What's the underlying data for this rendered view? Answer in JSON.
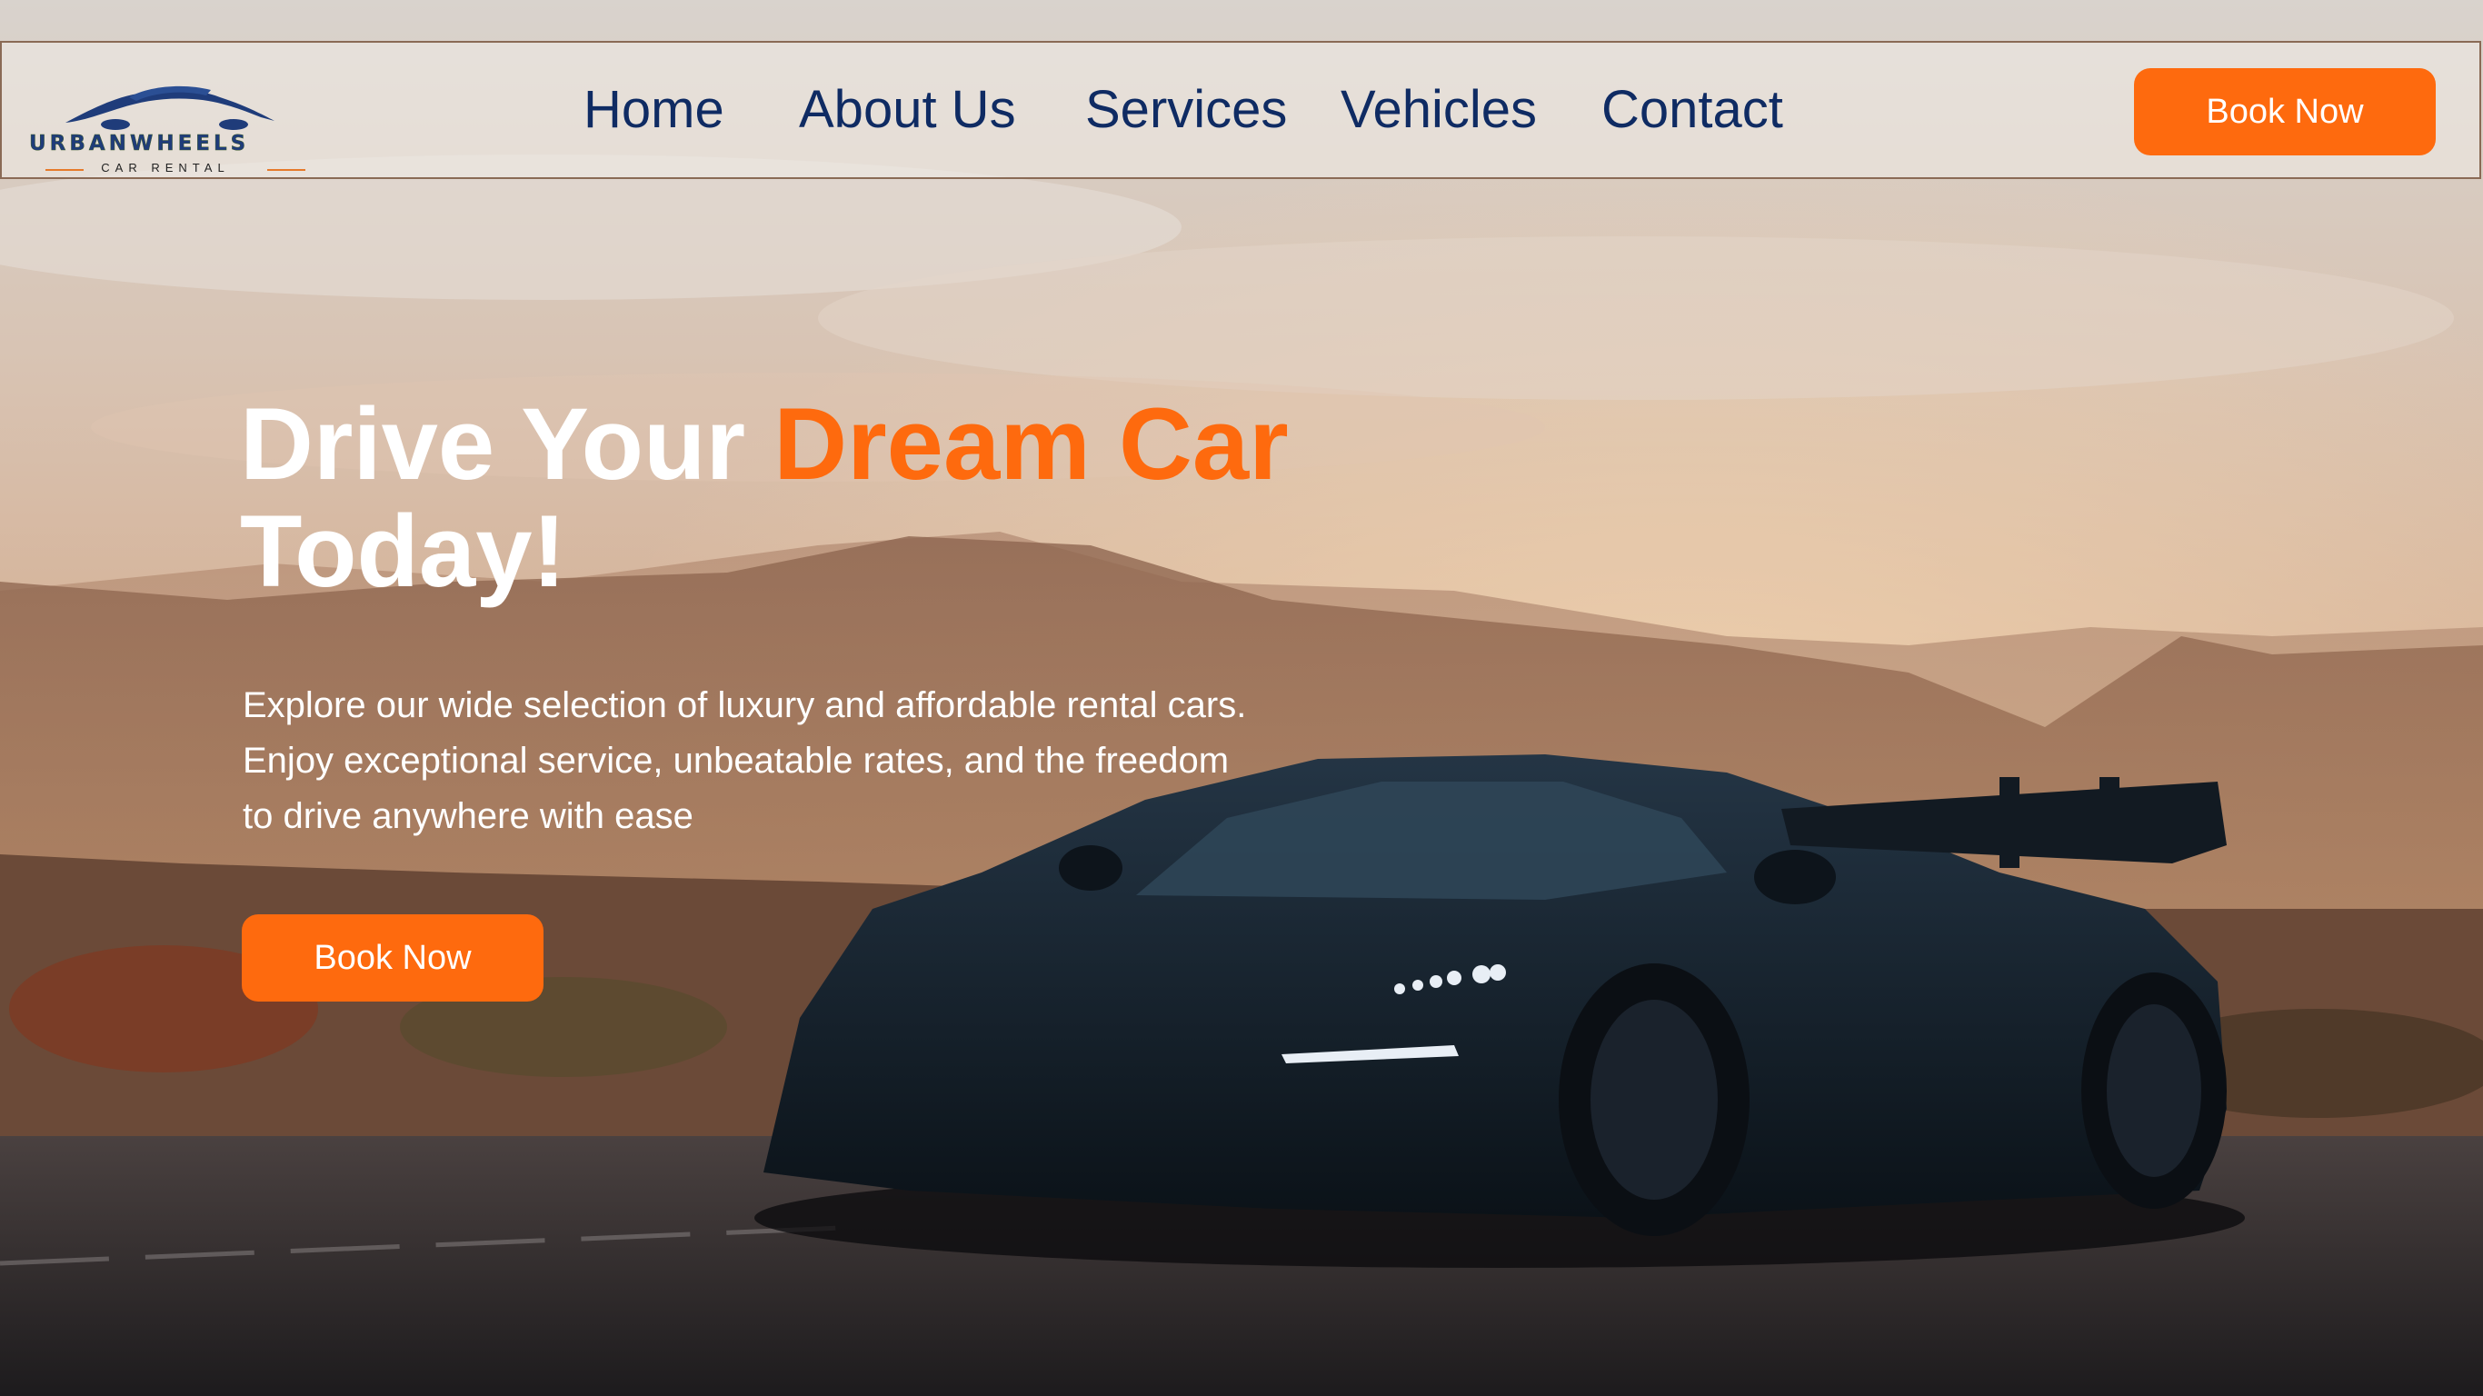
{
  "brand": {
    "logo_icon": "car-silhouette-icon",
    "name": "URBANWHEELS",
    "tagline": "CAR RENTAL"
  },
  "nav": {
    "items": [
      {
        "label": "Home"
      },
      {
        "label": "About Us"
      },
      {
        "label": "Services"
      },
      {
        "label": "Vehicles"
      },
      {
        "label": "Contact"
      }
    ],
    "cta_label": "Book Now"
  },
  "hero": {
    "title_part1": "Drive Your ",
    "title_accent": "Dream Car",
    "title_part2": "Today!",
    "description": "Explore our wide selection of luxury and affordable rental cars. Enjoy exceptional service, unbeatable rates, and the freedom to drive anywhere with ease",
    "cta_label": "Book Now",
    "background_image": "black-sports-car-at-sunset-mountains"
  },
  "colors": {
    "accent": "#fe6a0e",
    "nav_text": "#0f2b63",
    "hero_text": "#ffffff"
  }
}
